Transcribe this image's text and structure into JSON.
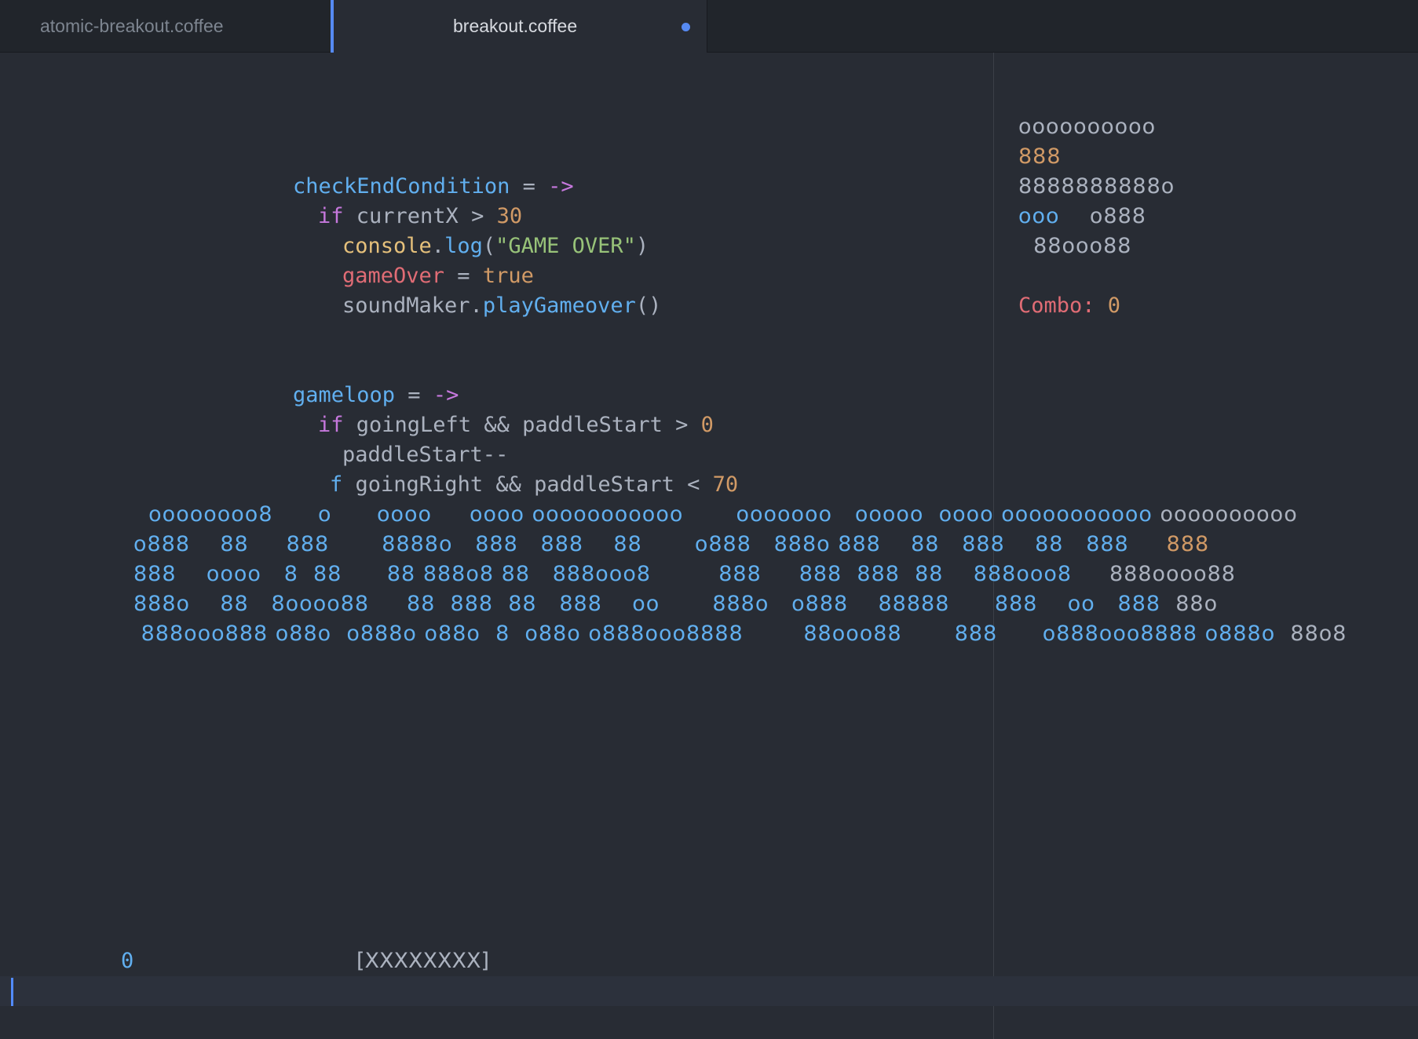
{
  "tabs": [
    {
      "label": "atomic-breakout.coffee"
    },
    {
      "label": "breakout.coffee"
    }
  ],
  "code": {
    "l1": {
      "name": "checkEndCondition",
      "eq": " = ",
      "arrow": "->"
    },
    "l2": {
      "kw": "if",
      "rest": " currentX > ",
      "num": "30"
    },
    "l3": {
      "obj": "console",
      "dot": ".",
      "fn": "log",
      "open": "(",
      "str": "\"GAME OVER\"",
      "close": ")"
    },
    "l4": {
      "var": "gameOver",
      "eq": " = ",
      "val": "true"
    },
    "l5": {
      "obj": "soundMaker.",
      "fn": "playGameover",
      "tail": "()"
    },
    "l6": {
      "name": "gameloop",
      "eq": " = ",
      "arrow": "->"
    },
    "l7": {
      "kw": "if",
      "rest": " goingLeft && paddleStart > ",
      "num": "0"
    },
    "l8": {
      "text": "paddleStart--"
    },
    "l9": {
      "kw": "f",
      "rest": " goingRight && paddleStart < ",
      "num": "70"
    }
  },
  "art": {
    "row1": {
      "a": "  oooooooo8      o      oooo     oooo ooooooooooo       ooooooo   ooooo  oooo ooooooooooo ",
      "b": "oooooooooo"
    },
    "row2": {
      "a": "o888    88     888       8888o   888   888    88       o888   888o 888    88   888    88   888     ",
      "b": "888"
    },
    "row3": {
      "a": "888    oooo   8  88      88 888o8 88   888ooo8         888     888  888  88    888ooo8     ",
      "b": "888oooo88"
    },
    "row4": {
      "a": "888o    88   8oooo88     88  888  88   888    oo       888o   o888    88888      888    oo   888  ",
      "b": "88o"
    },
    "row5": {
      "a": " 888ooo888 o88o  o888o o88o  8  o88o o888ooo8888        88ooo88       888      o888ooo8888 o888o  ",
      "b": "88o8"
    }
  },
  "sidebar": {
    "s1": "oooooooooo",
    "s2": "888",
    "s3": "8888888888o",
    "s4a": "ooo",
    "s4b": "    o888",
    "s5": "  88ooo88",
    "combo_label": "Combo: ",
    "combo_value": "0"
  },
  "footer": {
    "score": "0",
    "paddle": "[XXXXXXXX]"
  }
}
